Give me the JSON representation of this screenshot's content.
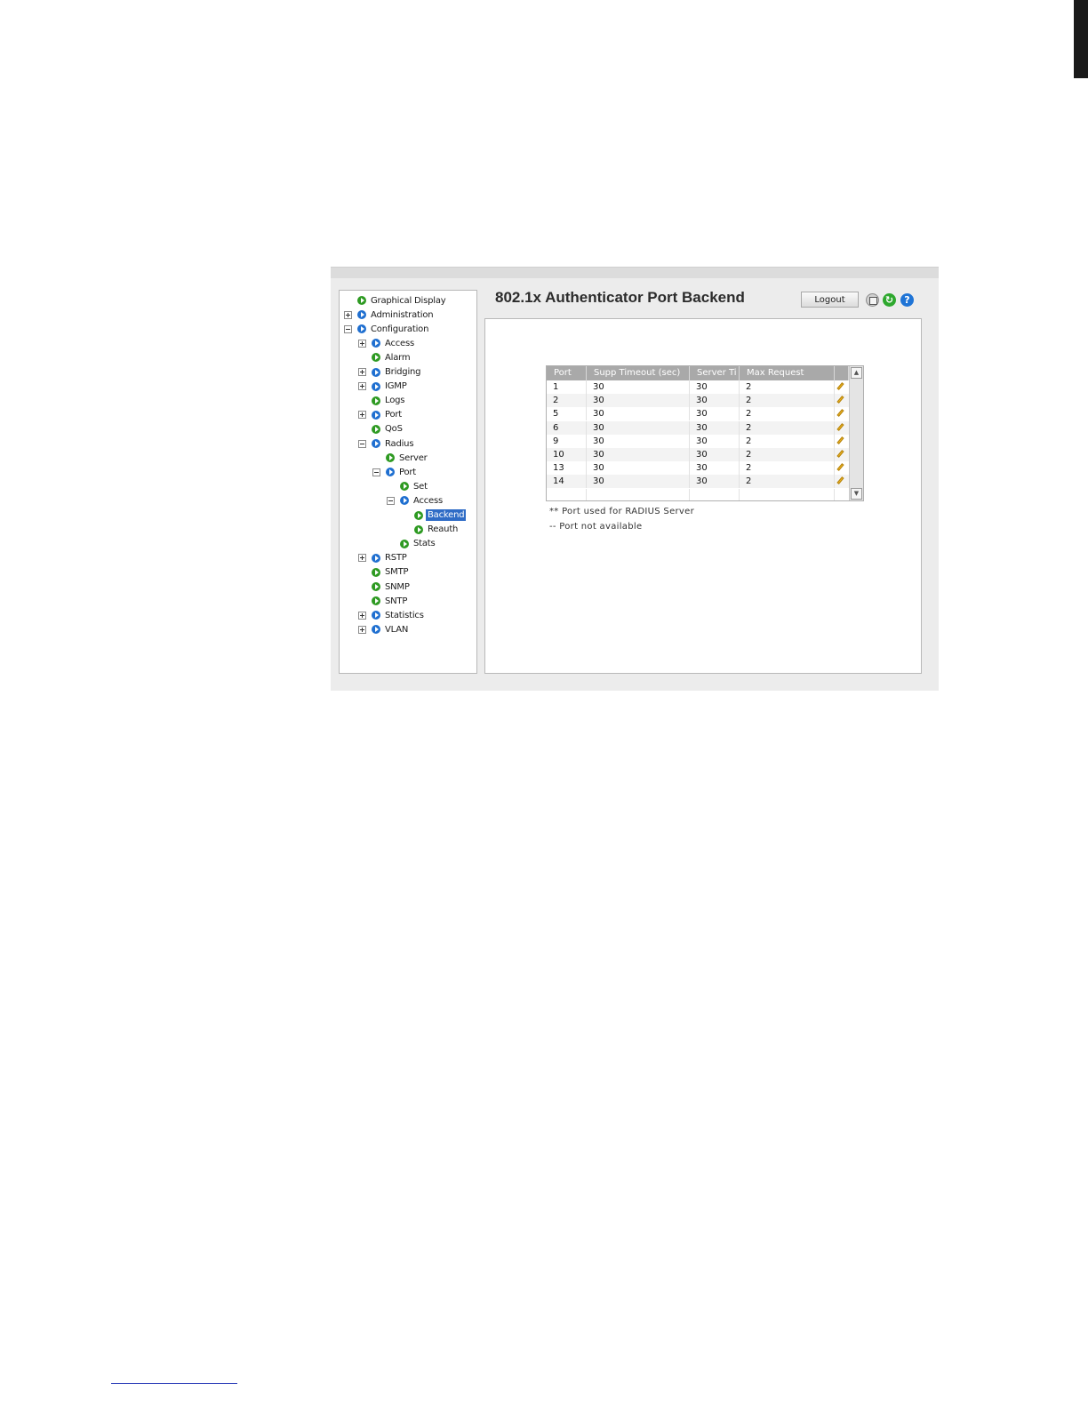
{
  "page_title": "802.1x Authenticator Port Backend",
  "toolbar": {
    "logout_label": "Logout",
    "save_icon": "floppy-disk",
    "refresh_icon": "green-refresh-arrows",
    "help_icon": "blue-question-mark",
    "refresh_glyph": "↻",
    "help_glyph": "?"
  },
  "nav": {
    "items": [
      {
        "label": "Graphical Display",
        "expander": null,
        "bullet": "green",
        "depth": 0
      },
      {
        "label": "Administration",
        "expander": "plus",
        "bullet": "blue",
        "depth": 0
      },
      {
        "label": "Configuration",
        "expander": "minus",
        "bullet": "blue",
        "depth": 0
      },
      {
        "label": "Access",
        "expander": "plus",
        "bullet": "blue",
        "depth": 1
      },
      {
        "label": "Alarm",
        "expander": null,
        "bullet": "green",
        "depth": 1
      },
      {
        "label": "Bridging",
        "expander": "plus",
        "bullet": "blue",
        "depth": 1
      },
      {
        "label": "IGMP",
        "expander": "plus",
        "bullet": "blue",
        "depth": 1
      },
      {
        "label": "Logs",
        "expander": null,
        "bullet": "green",
        "depth": 1
      },
      {
        "label": "Port",
        "expander": "plus",
        "bullet": "blue",
        "depth": 1
      },
      {
        "label": "QoS",
        "expander": null,
        "bullet": "green",
        "depth": 1
      },
      {
        "label": "Radius",
        "expander": "minus",
        "bullet": "blue",
        "depth": 1
      },
      {
        "label": "Server",
        "expander": null,
        "bullet": "green",
        "depth": 2
      },
      {
        "label": "Port",
        "expander": "minus",
        "bullet": "blue",
        "depth": 2
      },
      {
        "label": "Set",
        "expander": null,
        "bullet": "green",
        "depth": 3
      },
      {
        "label": "Access",
        "expander": "minus",
        "bullet": "blue",
        "depth": 3
      },
      {
        "label": "Backend",
        "expander": null,
        "bullet": "green",
        "depth": 4,
        "selected": true
      },
      {
        "label": "Reauth",
        "expander": null,
        "bullet": "green",
        "depth": 4
      },
      {
        "label": "Stats",
        "expander": null,
        "bullet": "green",
        "depth": 3
      },
      {
        "label": "RSTP",
        "expander": "plus",
        "bullet": "blue",
        "depth": 1
      },
      {
        "label": "SMTP",
        "expander": null,
        "bullet": "green",
        "depth": 1
      },
      {
        "label": "SNMP",
        "expander": null,
        "bullet": "green",
        "depth": 1
      },
      {
        "label": "SNTP",
        "expander": null,
        "bullet": "green",
        "depth": 1
      },
      {
        "label": "Statistics",
        "expander": "plus",
        "bullet": "blue",
        "depth": 1
      },
      {
        "label": "VLAN",
        "expander": "plus",
        "bullet": "blue",
        "depth": 1
      }
    ]
  },
  "table": {
    "columns": [
      "Port",
      "Supp Timeout (sec)",
      "Server Ti",
      "Max Request"
    ],
    "rows": [
      [
        "1",
        "30",
        "30",
        "2"
      ],
      [
        "2",
        "30",
        "30",
        "2"
      ],
      [
        "5",
        "30",
        "30",
        "2"
      ],
      [
        "6",
        "30",
        "30",
        "2"
      ],
      [
        "9",
        "30",
        "30",
        "2"
      ],
      [
        "10",
        "30",
        "30",
        "2"
      ],
      [
        "13",
        "30",
        "30",
        "2"
      ],
      [
        "14",
        "30",
        "30",
        "2"
      ]
    ],
    "row_action_icon": "pencil-edit",
    "scroll_up_glyph": "▲",
    "scroll_down_glyph": "▼"
  },
  "notes": {
    "radius_port": "** Port used for RADIUS Server",
    "not_available": "-- Port not available"
  },
  "colors": {
    "selected_background": "#2f6cc6",
    "table_header": "#a9a9a9",
    "page_edge": "#1a1a1a"
  }
}
